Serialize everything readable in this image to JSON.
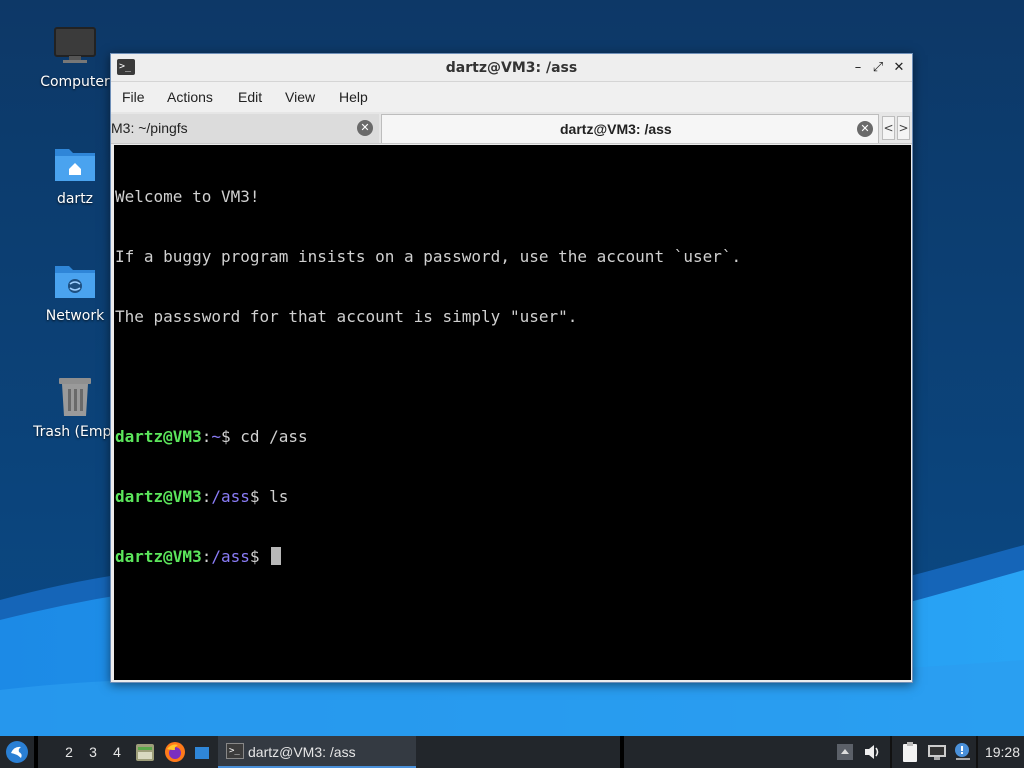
{
  "desktop": {
    "icons": [
      {
        "label": "Computer",
        "icon": "monitor-icon"
      },
      {
        "label": "dartz",
        "icon": "home-folder-icon"
      },
      {
        "label": "Network",
        "icon": "network-folder-icon"
      },
      {
        "label": "Trash (Empt",
        "icon": "trash-icon"
      }
    ]
  },
  "window": {
    "title": "dartz@VM3: /ass",
    "controls": {
      "minimize": "–",
      "maximize": "⤢",
      "close": "✕"
    },
    "menu": [
      "File",
      "Actions",
      "Edit",
      "View",
      "Help"
    ],
    "tabs": [
      {
        "label": "M3: ~/pingfs",
        "active": false
      },
      {
        "label": "dartz@VM3: /ass",
        "active": true
      }
    ],
    "tab_scroll": {
      "left": "<",
      "right": ">"
    }
  },
  "terminal": {
    "motd": [
      "Welcome to VM3!",
      "If a buggy program insists on a password, use the account `user`.",
      "The passsword for that account is simply \"user\"."
    ],
    "prompts": [
      {
        "user": "dartz@VM3",
        "sep": ":",
        "path": "~",
        "symbol": "$",
        "command": " cd /ass"
      },
      {
        "user": "dartz@VM3",
        "sep": ":",
        "path": "/ass",
        "symbol": "$",
        "command": " ls"
      },
      {
        "user": "dartz@VM3",
        "sep": ":",
        "path": "/ass",
        "symbol": "$",
        "command": " "
      }
    ]
  },
  "taskbar": {
    "workspaces": [
      "2",
      "3",
      "4"
    ],
    "task": {
      "label": "dartz@VM3: /ass"
    },
    "clock": "19:28"
  },
  "colors": {
    "prompt_user": "#5ce65c",
    "prompt_path": "#8a7cf7",
    "terminal_bg": "#000000",
    "taskbar_bg": "#22262b"
  }
}
